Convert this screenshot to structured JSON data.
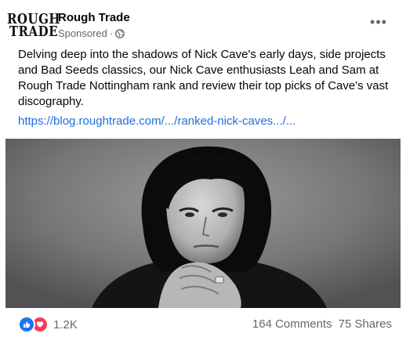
{
  "post": {
    "page_name": "Rough Trade",
    "logo_line1": "ROUGH",
    "logo_line2": "TRADE",
    "sponsored_label": "Sponsored",
    "meta_separator": "·",
    "more_label": "•••",
    "text": "Delving deep into the shadows of Nick Cave's early days, side projects and Bad Seeds classics, our Nick Cave enthusiasts Leah and Sam at Rough Trade Nottingham rank and review their top picks of Cave's vast discography.",
    "link_text": "https://blog.roughtrade.com/.../ranked-nick-caves.../...",
    "image_alt": "Black and white photo of Nick Cave"
  },
  "engagement": {
    "reaction_count": "1.2K",
    "comments": "164 Comments",
    "shares": "75 Shares"
  },
  "icons": {
    "globe": "globe-icon",
    "like": "like-reaction-icon",
    "love": "love-reaction-icon",
    "more": "more-options-icon"
  },
  "colors": {
    "link": "#216fdb",
    "secondary_text": "#65676b",
    "like_blue": "#1877f2",
    "love_red": "#f33e58"
  }
}
